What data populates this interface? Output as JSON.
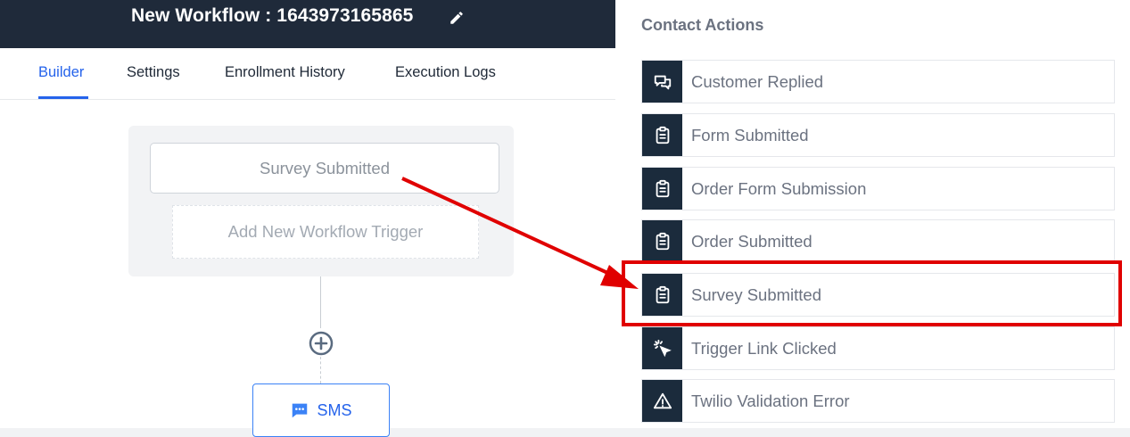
{
  "header": {
    "title": "New Workflow : 1643973165865"
  },
  "tabs": [
    {
      "label": "Builder",
      "active": true
    },
    {
      "label": "Settings",
      "active": false
    },
    {
      "label": "Enrollment History",
      "active": false
    },
    {
      "label": "Execution Logs",
      "active": false
    }
  ],
  "builder": {
    "trigger_label": "Survey Submitted",
    "add_trigger_label": "Add New Workflow Trigger",
    "action_label": "SMS"
  },
  "panel": {
    "title": "Contact Actions",
    "items": [
      {
        "label": "Customer Replied",
        "icon": "chat-bubbles-icon"
      },
      {
        "label": "Form Submitted",
        "icon": "clipboard-icon"
      },
      {
        "label": "Order Form Submission",
        "icon": "clipboard-icon"
      },
      {
        "label": "Order Submitted",
        "icon": "clipboard-icon"
      },
      {
        "label": "Survey Submitted",
        "icon": "clipboard-icon",
        "highlighted": true
      },
      {
        "label": "Trigger Link Clicked",
        "icon": "cursor-click-icon"
      },
      {
        "label": "Twilio Validation Error",
        "icon": "warning-triangle-icon"
      }
    ]
  },
  "colors": {
    "header_bg": "#1f2a3a",
    "accent": "#2563eb",
    "icon_bg": "#1b2b3c",
    "highlight": "#e00000"
  }
}
